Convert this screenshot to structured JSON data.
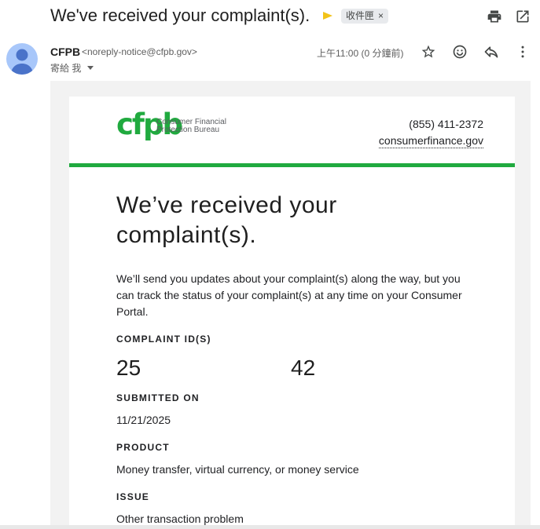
{
  "email": {
    "subject": "We've received your complaint(s).",
    "label": "收件匣",
    "label_close": "×",
    "sender_name": "CFPB",
    "sender_email": "<noreply-notice@cfpb.gov>",
    "recipient": "寄給 我",
    "timestamp": "上午11:00 (0 分鐘前)"
  },
  "icons": {
    "print": "print-icon",
    "open_new_window": "open-in-new-icon",
    "star": "star-icon",
    "emoji": "emoji-icon",
    "reply": "reply-icon",
    "more": "more-vert-icon"
  },
  "body": {
    "logo_mark": "cfpb",
    "logo_line1": "Consumer Financial",
    "logo_line2": "Protection Bureau",
    "phone": "(855) 411-2372",
    "website": "consumerfinance.gov",
    "headline": "We’ve received your complaint(s).",
    "intro": "We’ll send you updates about your complaint(s) along the way, but you can track the status of your complaint(s) at any time on your Consumer Portal.",
    "complaint_id_label": "COMPLAINT ID(S)",
    "complaint_id_start": "25",
    "complaint_id_end": "42",
    "submitted_label": "SUBMITTED ON",
    "submitted_value": "11/21/2025",
    "product_label": "PRODUCT",
    "product_value": "Money transfer, virtual currency, or money service",
    "issue_label": "ISSUE",
    "issue_value": "Other transaction problem"
  },
  "colors": {
    "brand_green": "#20aa3f",
    "brand_light_green": "#addc91",
    "importance_marker": "#f2c319"
  }
}
